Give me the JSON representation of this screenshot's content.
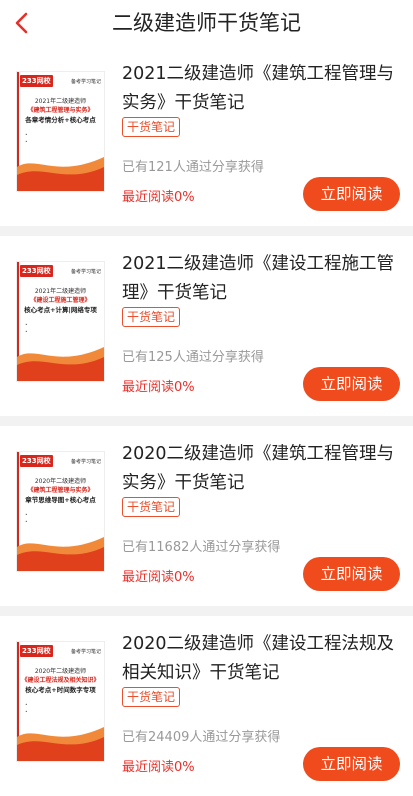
{
  "header": {
    "title": "二级建造师干货笔记"
  },
  "books": [
    {
      "title": "2021二级建造师《建筑工程管理与实务》干货笔记",
      "tag": "干货笔记",
      "share": "已有121人通过分享获得",
      "recent": "最近阅读0%",
      "button": "立即阅读",
      "cover": {
        "logo": "233网校",
        "series": "备考学习笔记",
        "l1": "2021年二级建造师",
        "l2": "《建筑工程管理与实务》",
        "l3": "各章考情分析+核心考点"
      }
    },
    {
      "title": "2021二级建造师《建设工程施工管理》干货笔记",
      "tag": "干货笔记",
      "share": "已有125人通过分享获得",
      "recent": "最近阅读0%",
      "button": "立即阅读",
      "cover": {
        "logo": "233网校",
        "series": "备考学习笔记",
        "l1": "2021年二级建造师",
        "l2": "《建设工程施工管理》",
        "l3": "核心考点+计算|网络专项"
      }
    },
    {
      "title": "2020二级建造师《建筑工程管理与实务》干货笔记",
      "tag": "干货笔记",
      "share": "已有11682人通过分享获得",
      "recent": "最近阅读0%",
      "button": "立即阅读",
      "cover": {
        "logo": "233网校",
        "series": "备考学习笔记",
        "l1": "2020年二级建造师",
        "l2": "《建筑工程管理与实务》",
        "l3": "章节思维导图+核心考点"
      }
    },
    {
      "title": "2020二级建造师《建设工程法规及相关知识》干货笔记",
      "tag": "干货笔记",
      "share": "已有24409人通过分享获得",
      "recent": "最近阅读0%",
      "button": "立即阅读",
      "cover": {
        "logo": "233网校",
        "series": "备考学习笔记",
        "l1": "2020年二级建造师",
        "l2": "《建设工程法规及相关知识》",
        "l3": "核心考点+时间数字专项"
      }
    }
  ],
  "colors": {
    "accent": "#ef4b1d",
    "brand": "#d8261c",
    "tag": "#e8502e"
  }
}
